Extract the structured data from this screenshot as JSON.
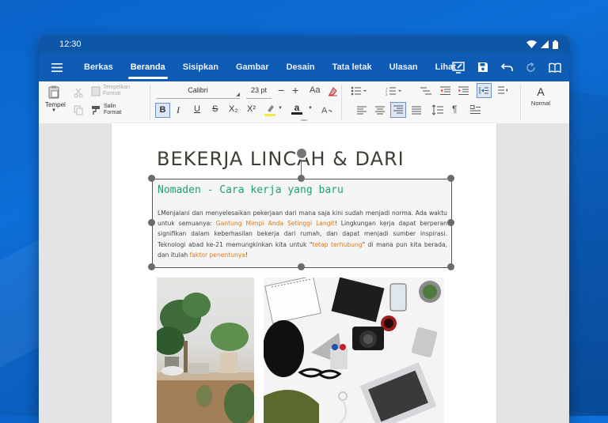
{
  "status": {
    "time": "12:30"
  },
  "menu": {
    "tabs": [
      "Berkas",
      "Beranda",
      "Sisipkan",
      "Gambar",
      "Desain",
      "Tata letak",
      "Ulasan",
      "Lihat"
    ],
    "active_index": 1
  },
  "ribbon": {
    "paste_label": "Tempel",
    "paste_format_label": "Tempelkan Format",
    "copy_format_label": "Salin Format",
    "font_name": "Calibri",
    "font_size": "23 pt",
    "aa_label": "Aa",
    "bold": "B",
    "italic": "I",
    "underline": "U",
    "strike": "S",
    "subscript": "X₂",
    "superscript": "X²",
    "style_letter": "A",
    "style_name": "Normal",
    "font_color_letter": "a"
  },
  "document": {
    "title": "BEKERJA LINCAH & DARI",
    "heading": "Nomaden - Cara kerja yang baru",
    "body_parts": [
      "LMenjalani dan menyelesaikan pekerjaan dari mana saja kini sudah menjadi norma. Ada waktu untuk semuanya: ",
      "Gantung Mimpi Anda Setinggi Langit",
      "! Lingkungan kerja dapat berperan signifikan dalam keberhasilan bekerja dari rumah, dan dapat menjadi sumber inspirasi. Teknologi abad ke-21 memungkinkan kita untuk \"",
      "tetap terhubung",
      "\" di mana pun kita berada, dan itulah ",
      "faktor penentunya",
      "!"
    ]
  },
  "colors": {
    "menubar": "#0f5cb5",
    "statusbar": "#0e56a8",
    "heading": "#1f9d7a",
    "highlight": "#d9791b",
    "title": "#3f3f35"
  }
}
